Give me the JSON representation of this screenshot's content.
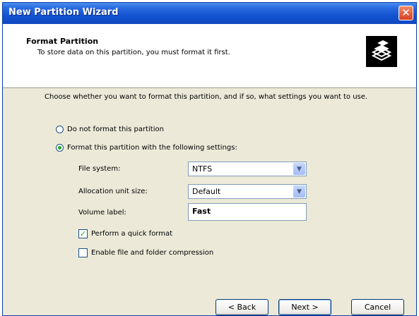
{
  "window": {
    "title": "New Partition Wizard"
  },
  "header": {
    "title": "Format Partition",
    "subtitle": "To store data on this partition, you must format it first.",
    "icon": "format-disk-icon"
  },
  "intro": "Choose whether you want to format this partition, and if so, what settings you want to use.",
  "options": {
    "no_format": {
      "label": "Do not format this partition",
      "selected": false
    },
    "format": {
      "label": "Format this partition with the following settings:",
      "selected": true
    }
  },
  "settings": {
    "file_system": {
      "label": "File system:",
      "value": "NTFS"
    },
    "allocation": {
      "label": "Allocation unit size:",
      "value": "Default"
    },
    "volume_label": {
      "label": "Volume label:",
      "value": "Fast"
    }
  },
  "checks": {
    "quick_format": {
      "label": "Perform a quick format",
      "checked": true
    },
    "compression": {
      "label": "Enable file and folder compression",
      "checked": false
    }
  },
  "buttons": {
    "back": "< Back",
    "next": "Next >",
    "cancel": "Cancel"
  },
  "colors": {
    "titlebar": "#1453d0",
    "dialog_bg": "#ece9d8",
    "check": "#21a121"
  }
}
